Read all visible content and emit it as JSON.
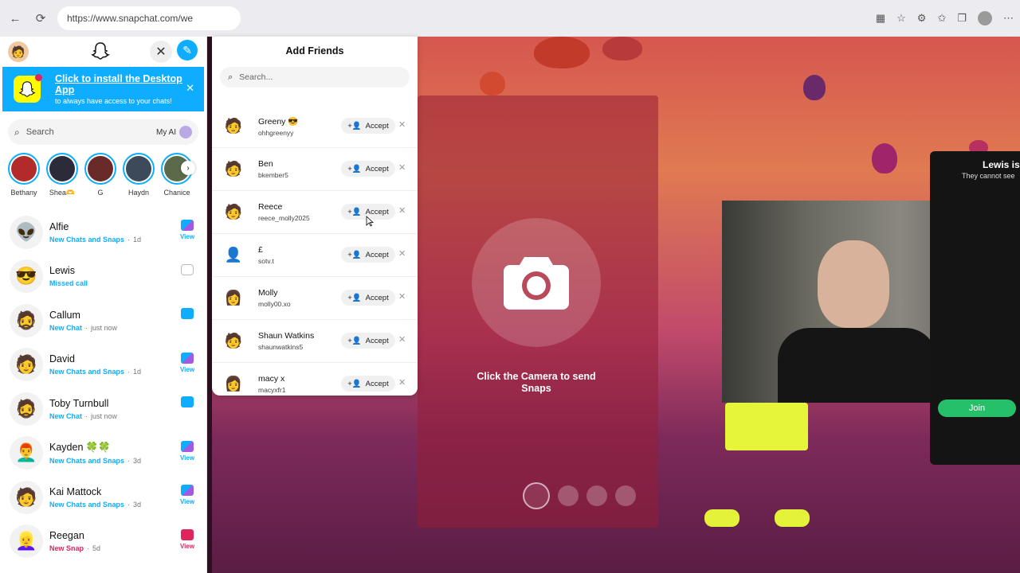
{
  "browser": {
    "url": "https://www.snapchat.com/we",
    "nav_back": "←",
    "nav_reload": "⟳"
  },
  "sidebar": {
    "install_banner": {
      "title": "Click to install the Desktop App",
      "subtitle": "to always have access to your chats!"
    },
    "search_placeholder": "Search",
    "my_ai_label": "My AI",
    "stories": [
      {
        "name": "Bethany",
        "color": "#b22a2a"
      },
      {
        "name": "Shea🫶",
        "color": "#2b2b3a"
      },
      {
        "name": "G",
        "color": "#6a2a2a"
      },
      {
        "name": "Haydn",
        "color": "#3c4a5a"
      },
      {
        "name": "Chanice",
        "color": "#5a6a4a"
      }
    ],
    "chats": [
      {
        "name": "Alfie",
        "status": "New Chats and Snaps",
        "time": "1d",
        "status_color": "blue",
        "action": "View",
        "icon": "chat-snap-icon",
        "avatar": "👽"
      },
      {
        "name": "Lewis",
        "status": "Missed call",
        "time": "",
        "status_color": "blue",
        "action": "",
        "icon": "camera-icon",
        "avatar": "😎"
      },
      {
        "name": "Callum",
        "status": "New Chat",
        "time": "just now",
        "status_color": "blue",
        "action": "",
        "icon": "chat-icon",
        "avatar": "🧔"
      },
      {
        "name": "David",
        "status": "New Chats and Snaps",
        "time": "1d",
        "status_color": "blue",
        "action": "View",
        "icon": "chat-snap-icon",
        "avatar": "🧑"
      },
      {
        "name": "Toby Turnbull",
        "status": "New Chat",
        "time": "just now",
        "status_color": "blue",
        "action": "",
        "icon": "chat-icon",
        "avatar": "🧔"
      },
      {
        "name": "Kayden 🍀🍀",
        "status": "New Chats and Snaps",
        "time": "3d",
        "status_color": "blue",
        "action": "View",
        "icon": "chat-snap-icon",
        "avatar": "👨‍🦰"
      },
      {
        "name": "Kai Mattock",
        "status": "New Chats and Snaps",
        "time": "3d",
        "status_color": "blue",
        "action": "View",
        "icon": "chat-snap-icon",
        "avatar": "🧑"
      },
      {
        "name": "Reegan",
        "status": "New Snap",
        "time": "5d",
        "status_color": "red",
        "action": "View",
        "icon": "snap-icon",
        "avatar": "👱‍♀️"
      }
    ]
  },
  "add_friends": {
    "title": "Add Friends",
    "search_placeholder": "Search...",
    "accept_label": "Accept",
    "requests": [
      {
        "name": "Greeny 😎",
        "username": "ohhgreenyy",
        "avatar": "🧑"
      },
      {
        "name": "Ben",
        "username": "bkember5",
        "avatar": "🧑"
      },
      {
        "name": "Reece",
        "username": "reece_molly2025",
        "avatar": "🧑"
      },
      {
        "name": "£",
        "username": "sotv.t",
        "avatar": "👤"
      },
      {
        "name": "Molly",
        "username": "molly00.xo",
        "avatar": "👩"
      },
      {
        "name": "Shaun Watkins",
        "username": "shaunwatkins5",
        "avatar": "🧑"
      },
      {
        "name": "macy x",
        "username": "macyxfr1",
        "avatar": "👩"
      }
    ]
  },
  "camera": {
    "hint": "Click the Camera to send Snaps"
  },
  "call_card": {
    "title": "Lewis is",
    "subtitle": "They cannot see",
    "join_label": "Join"
  },
  "colors": {
    "snap_blue": "#0fadff",
    "snap_yellow": "#fffc00",
    "snap_red": "#e0245e",
    "join_green": "#27c06a"
  }
}
